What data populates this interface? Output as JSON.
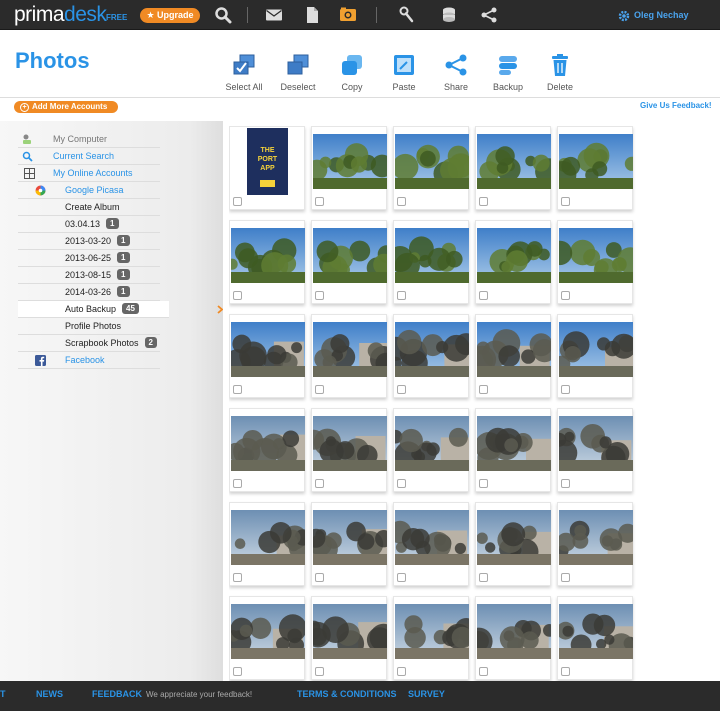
{
  "brand": {
    "name_a": "prima",
    "name_b": "desk",
    "edition": "FREE"
  },
  "topbar": {
    "upgrade_label": "★ Upgrade",
    "user_name": "Oleg Nechay",
    "icons": [
      "search-icon",
      "mail-icon",
      "document-icon",
      "photo-icon",
      "tools-icon",
      "backup-icon",
      "share-icon"
    ]
  },
  "page_title": "Photos",
  "toolbar": {
    "select_all": "Select All",
    "deselect": "Deselect",
    "copy": "Copy",
    "paste": "Paste",
    "share": "Share",
    "backup": "Backup",
    "delete": "Delete"
  },
  "add_accounts_label": "Add More Accounts",
  "feedback_label": "Give Us Feedback!",
  "sidebar": {
    "my_computer": "My Computer",
    "current_search": "Current Search",
    "my_online_accounts": "My Online Accounts",
    "google_picasa": "Google Picasa",
    "create_album": "Create Album",
    "albums": [
      {
        "label": "03.04.13",
        "count": "1"
      },
      {
        "label": "2013-03-20",
        "count": "1"
      },
      {
        "label": "2013-06-25",
        "count": "1"
      },
      {
        "label": "2013-08-15",
        "count": "1"
      },
      {
        "label": "2014-03-26",
        "count": "1"
      },
      {
        "label": "Auto Backup",
        "count": "45"
      },
      {
        "label": "Profile Photos",
        "count": ""
      },
      {
        "label": "Scrapbook Photos",
        "count": "2"
      }
    ],
    "facebook": "Facebook",
    "selected": "Auto Backup"
  },
  "cover_text": {
    "line1": "THE",
    "line2": "PORT",
    "line3": "APP"
  },
  "colors": {
    "accent": "#2a93e6",
    "orange": "#f08a24",
    "bar": "#2b2b2b"
  },
  "footer": {
    "edge": "T",
    "news": "NEWS",
    "feedback": "FEEDBACK",
    "feedback_note": "We appreciate your feedback!",
    "terms": "TERMS & CONDITIONS",
    "survey": "SURVEY"
  }
}
